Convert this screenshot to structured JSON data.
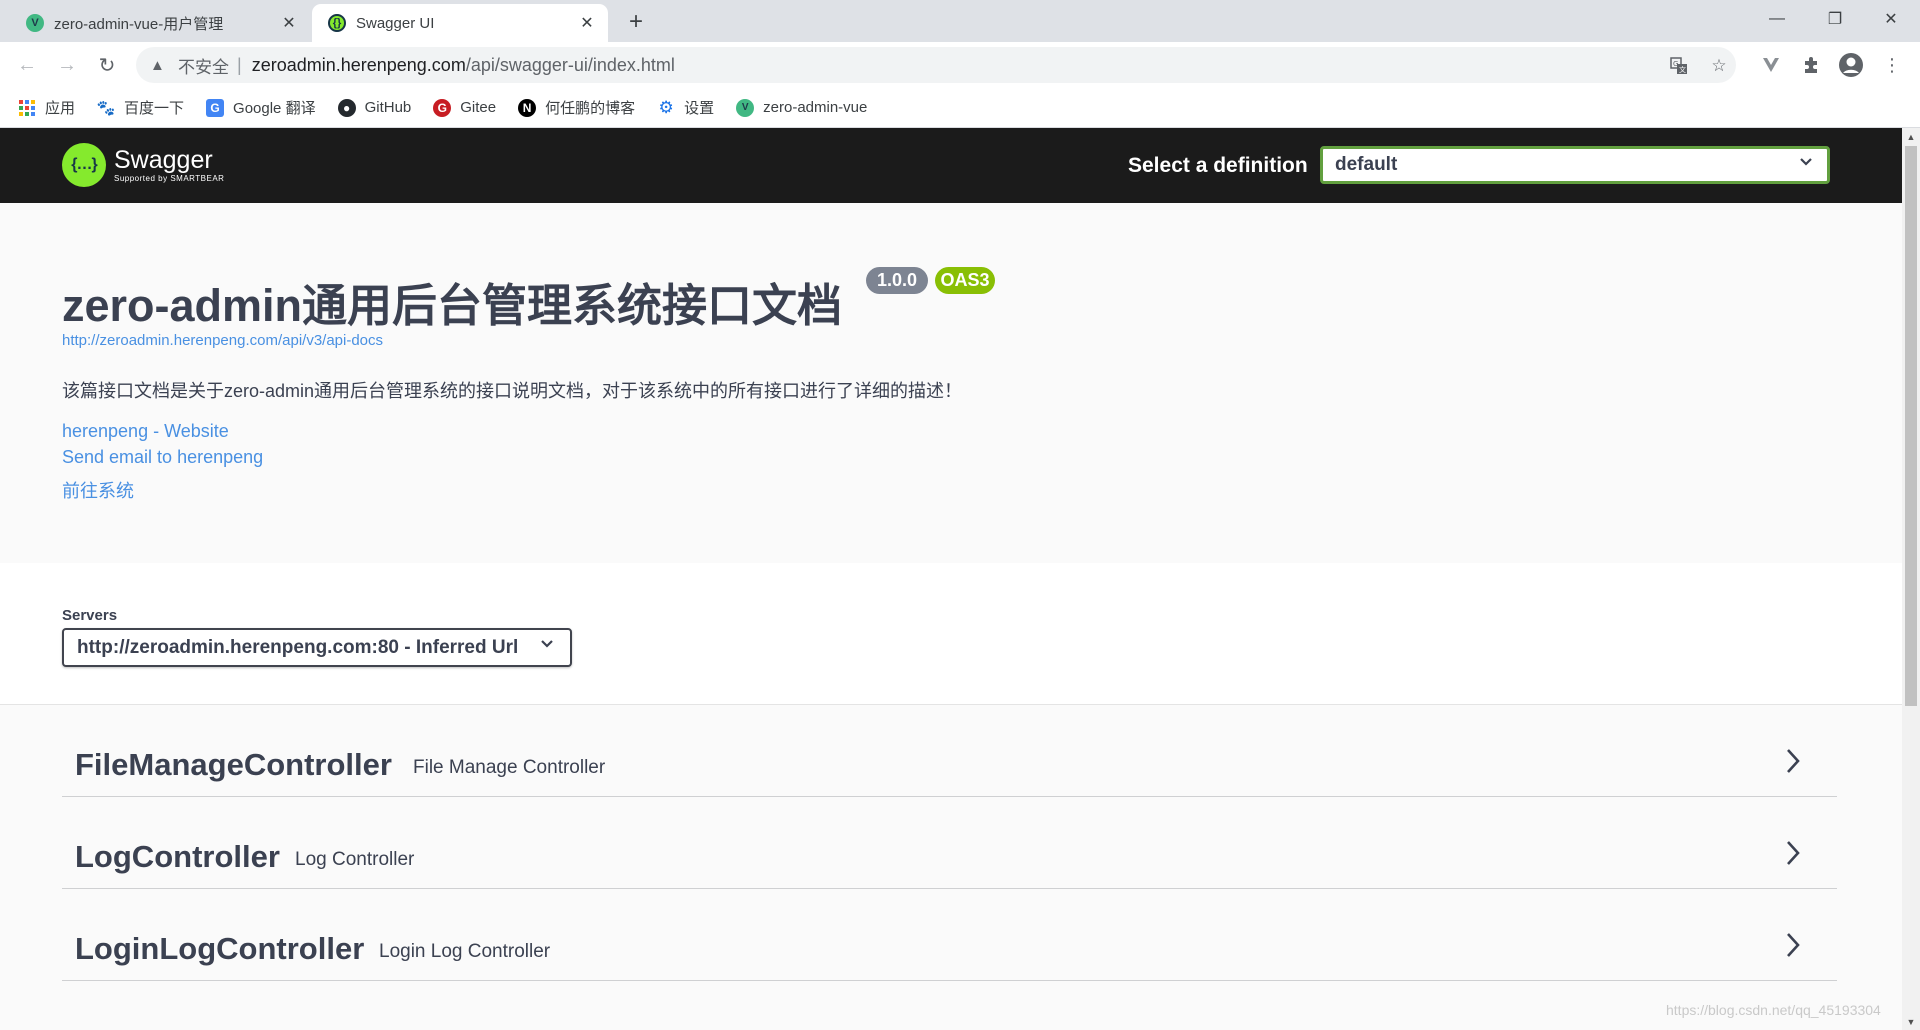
{
  "browser": {
    "tabs": [
      {
        "title": "zero-admin-vue-用户管理",
        "favicon": "vue-icon",
        "active": false
      },
      {
        "title": "Swagger UI",
        "favicon": "swagger-icon",
        "active": true
      }
    ],
    "new_tab": "+",
    "window_controls": {
      "minimize": "—",
      "restore": "❐",
      "close": "✕"
    },
    "nav": {
      "back": "←",
      "forward": "→",
      "reload": "↻"
    },
    "omnibox": {
      "security_icon": "warning-triangle-icon",
      "security_text": "不安全",
      "host": "zeroadmin.herenpeng.com",
      "path": "/api/swagger-ui/index.html"
    },
    "icons": [
      "translate-icon",
      "star-icon",
      "vue-devtools-icon",
      "extensions-icon",
      "profile-icon",
      "menu-icon"
    ],
    "bookmarks": [
      {
        "label": "应用",
        "icon": "apps-grid-icon"
      },
      {
        "label": "百度一下",
        "icon": "baidu-icon"
      },
      {
        "label": "Google 翻译",
        "icon": "google-translate-icon"
      },
      {
        "label": "GitHub",
        "icon": "github-icon"
      },
      {
        "label": "Gitee",
        "icon": "gitee-icon"
      },
      {
        "label": "何任鹏的博客",
        "icon": "notion-icon"
      },
      {
        "label": "设置",
        "icon": "settings-gear-icon"
      },
      {
        "label": "zero-admin-vue",
        "icon": "vue-icon"
      }
    ]
  },
  "swagger": {
    "logo": {
      "name": "Swagger",
      "sub": "Supported by SMARTBEAR"
    },
    "definition": {
      "label": "Select a definition",
      "selected": "default"
    },
    "info": {
      "title": "zero-admin通用后台管理系统接口文档",
      "version": "1.0.0",
      "oas": "OAS3",
      "url": "http://zeroadmin.herenpeng.com/api/v3/api-docs",
      "description": "该篇接口文档是关于zero-admin通用后台管理系统的接口说明文档，对于该系统中的所有接口进行了详细的描述！",
      "links": [
        "herenpeng - Website",
        "Send email to herenpeng",
        "前往系统"
      ]
    },
    "servers": {
      "label": "Servers",
      "selected": "http://zeroadmin.herenpeng.com:80 - Inferred Url"
    },
    "controllers": [
      {
        "name": "FileManageController",
        "description": "File Manage Controller"
      },
      {
        "name": "LogController",
        "description": "Log Controller"
      },
      {
        "name": "LoginLogController",
        "description": "Login Log Controller"
      }
    ]
  },
  "watermark": "https://blog.csdn.net/qq_45193304",
  "colors": {
    "swagger_green": "#85ea2d",
    "topbar": "#1b1b1b",
    "link": "#4990e2",
    "select_border": "#62a03f",
    "oas_badge": "#89bf04",
    "version_badge": "#7d8492"
  }
}
